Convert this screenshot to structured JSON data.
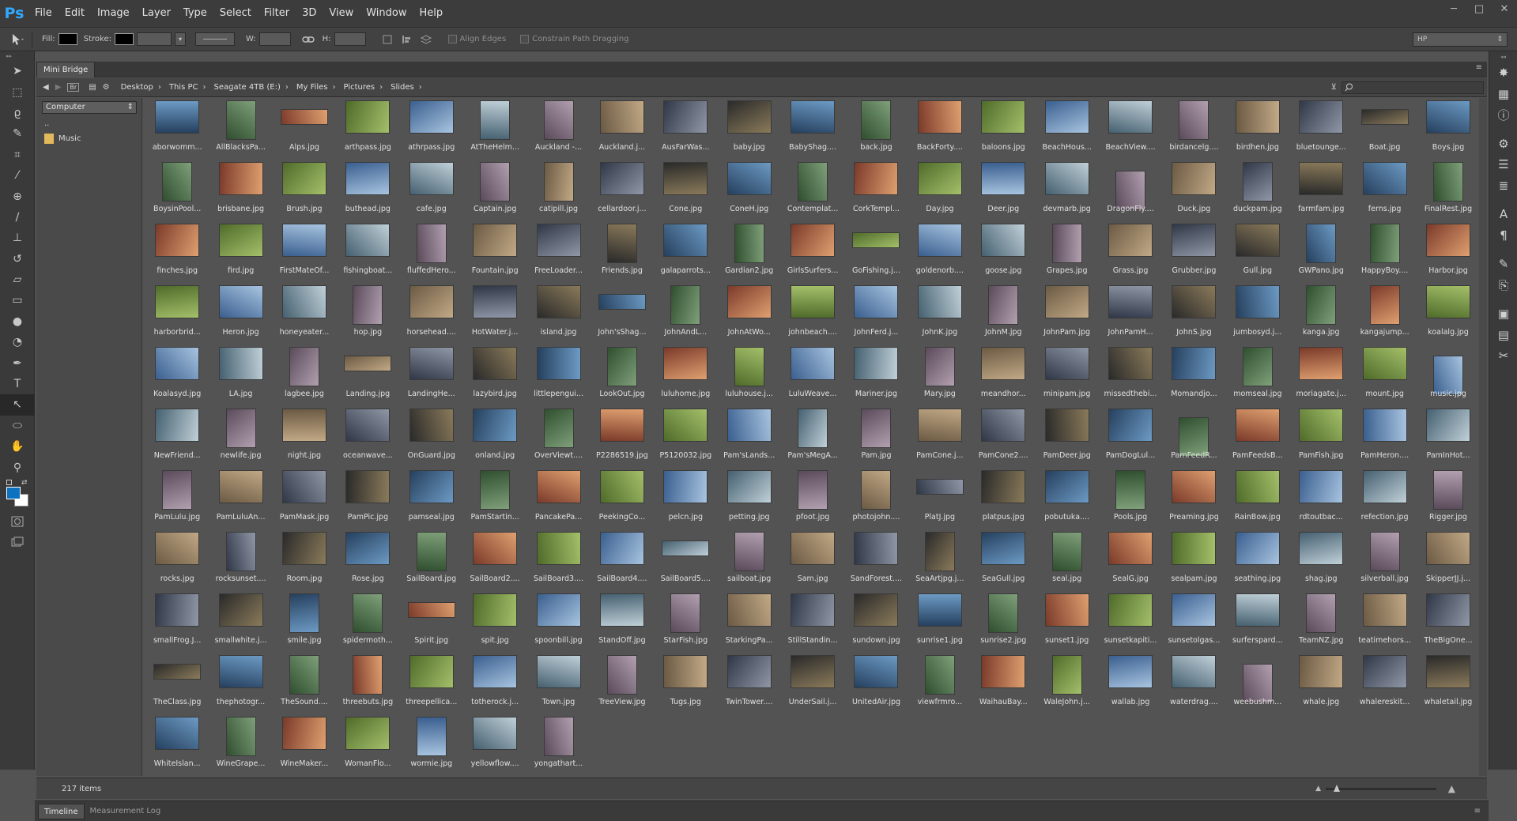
{
  "app": {
    "logo": "Ps"
  },
  "menus": [
    "File",
    "Edit",
    "Image",
    "Layer",
    "Type",
    "Select",
    "Filter",
    "3D",
    "View",
    "Window",
    "Help"
  ],
  "window_controls": [
    "─",
    "□",
    "✕"
  ],
  "options": {
    "fill_label": "Fill:",
    "stroke_label": "Stroke:",
    "w_label": "W:",
    "h_label": "H:",
    "align_edges": "Align Edges",
    "constrain": "Constrain Path Dragging",
    "workspace": "HP"
  },
  "panel": {
    "tab": "Mini Bridge",
    "location": "Computer",
    "folders": [
      "..",
      "Music"
    ]
  },
  "breadcrumb": [
    "Desktop",
    "This PC",
    "Seagate 4TB (E:)",
    "My Files",
    "Pictures",
    "Slides"
  ],
  "status": {
    "count": "217 items"
  },
  "bottom_tabs": [
    "Timeline",
    "Measurement Log"
  ],
  "icons": {
    "tools": [
      "move-icon",
      "marquee-icon",
      "lasso-icon",
      "quick-select-icon",
      "crop-icon",
      "eyedropper-icon",
      "healing-icon",
      "brush-icon",
      "stamp-icon",
      "history-brush-icon",
      "eraser-icon",
      "gradient-icon",
      "blur-icon",
      "dodge-icon",
      "pen-icon",
      "type-icon",
      "path-select-icon",
      "shape-icon",
      "hand-icon",
      "zoom-icon"
    ],
    "right": [
      "color-icon",
      "swatches-icon",
      "info-icon",
      "adjustments-icon",
      "layers-icon",
      "channels-icon",
      "character-icon",
      "paragraph-icon",
      "brushes-icon",
      "clone-source-icon",
      "navigator-icon",
      "notes-icon",
      "tool-presets-icon"
    ]
  },
  "files": [
    "aborwomm...",
    "AllBlacksPa...",
    "Alps.jpg",
    "arthpass.jpg",
    "athrpass.jpg",
    "AtTheHelm...",
    "Auckland -...",
    "Auckland.j...",
    "AusFarWas...",
    "baby.jpg",
    "BabyShag....",
    "back.jpg",
    "BackForty....",
    "baloons.jpg",
    "BeachHous...",
    "BeachView....",
    "birdancelg....",
    "birdhen.jpg",
    "bluetounge...",
    "Boat.jpg",
    "Boys.jpg",
    "BoysinPool...",
    "brisbane.jpg",
    "Brush.jpg",
    "buthead.jpg",
    "cafe.jpg",
    "Captain.jpg",
    "catipill.jpg",
    "cellardoor.j...",
    "Cone.jpg",
    "ConeH.jpg",
    "Contemplat...",
    "CorkTempl...",
    "Day.jpg",
    "Deer.jpg",
    "devmarb.jpg",
    "DragonFly....",
    "Duck.jpg",
    "duckpam.jpg",
    "farmfam.jpg",
    "ferns.jpg",
    "FinalRest.jpg",
    "finches.jpg",
    "fird.jpg",
    "FirstMateOf...",
    "fishingboat...",
    "fluffedHero...",
    "Fountain.jpg",
    "FreeLoader...",
    "Friends.jpg",
    "galaparrots...",
    "Gardian2.jpg",
    "GirlsSurfers...",
    "GoFishing.j...",
    "goldenorb....",
    "goose.jpg",
    "Grapes.jpg",
    "Grass.jpg",
    "Grubber.jpg",
    "Gull.jpg",
    "GWPano.jpg",
    "HappyBoy....",
    "Harbor.jpg",
    "harborbrid...",
    "Heron.jpg",
    "honeyeater...",
    "hop.jpg",
    "horsehead....",
    "HotWater.j...",
    "island.jpg",
    "John'sShag...",
    "JohnAndL...",
    "JohnAtWo...",
    "johnbeach....",
    "JohnFerd.j...",
    "JohnK.jpg",
    "JohnM.jpg",
    "JohnPam.jpg",
    "JohnPamH...",
    "JohnS.jpg",
    "jumbosyd.j...",
    "kanga.jpg",
    "kangajump...",
    "koalalg.jpg",
    "Koalasyd.jpg",
    "LA.jpg",
    "lagbee.jpg",
    "Landing.jpg",
    "LandingHe...",
    "lazybird.jpg",
    "littlepengui...",
    "LookOut.jpg",
    "luluhome.jpg",
    "luluhouse.j...",
    "LuluWeave...",
    "Mariner.jpg",
    "Mary.jpg",
    "meandhor...",
    "minipam.jpg",
    "missedthebi...",
    "Momandjo...",
    "momseal.jpg",
    "moriagate.j...",
    "mount.jpg",
    "music.jpg",
    "NewFriend...",
    "newlife.jpg",
    "night.jpg",
    "oceanwave...",
    "OnGuard.jpg",
    "onland.jpg",
    "OverViewt....",
    "P2286519.jpg",
    "P5120032.jpg",
    "Pam'sLands...",
    "Pam'sMegA...",
    "Pam.jpg",
    "PamCone.j...",
    "PamCone2....",
    "PamDeer.jpg",
    "PamDogLul...",
    "PamFeedR...",
    "PamFeedsB...",
    "PamFish.jpg",
    "PamHeron....",
    "PamInHot...",
    "PamLulu.jpg",
    "PamLuluAn...",
    "PamMask.jpg",
    "PamPic.jpg",
    "pamseal.jpg",
    "PamStartin...",
    "PancakePa...",
    "PeekingCo...",
    "pelcn.jpg",
    "petting.jpg",
    "pfoot.jpg",
    "photojohn....",
    "PlatJ.jpg",
    "platpus.jpg",
    "pobutuka....",
    "Pools.jpg",
    "Preaming.jpg",
    "RainBow.jpg",
    "rdtoutbac...",
    "refection.jpg",
    "Rigger.jpg",
    "rocks.jpg",
    "rocksunset....",
    "Room.jpg",
    "Rose.jpg",
    "SailBoard.jpg",
    "SailBoard2....",
    "SailBoard3....",
    "SailBoard4....",
    "SailBoard5....",
    "sailboat.jpg",
    "Sam.jpg",
    "SandForest....",
    "SeaArtjpg.j...",
    "SeaGull.jpg",
    "seal.jpg",
    "SealG.jpg",
    "sealpam.jpg",
    "seathing.jpg",
    "shag.jpg",
    "silverball.jpg",
    "SkipperJJ.j...",
    "smallFrog.J...",
    "smallwhite.j...",
    "smile.jpg",
    "spidermoth...",
    "Spirit.jpg",
    "spit.jpg",
    "spoonbill.jpg",
    "StandOff.jpg",
    "StarFish.jpg",
    "StarkingPa...",
    "StillStandin...",
    "sundown.jpg",
    "sunrise1.jpg",
    "sunrise2.jpg",
    "sunset1.jpg",
    "sunsetkapiti...",
    "sunsetolgas...",
    "surferspard...",
    "TeamNZ.jpg",
    "teatimehors...",
    "TheBigOne...",
    "TheClass.jpg",
    "thephotogr...",
    "TheSound....",
    "threebuts.jpg",
    "threepellica...",
    "totherock.j...",
    "Town.jpg",
    "TreeView.jpg",
    "Tugs.jpg",
    "TwinTower....",
    "UnderSail.j...",
    "UnitedAir.jpg",
    "viewfrmro...",
    "WaihauBay...",
    "WaleJohn.j...",
    "wallab.jpg",
    "waterdrag....",
    "weebushm...",
    "whale.jpg",
    "whalereskit...",
    "whaletail.jpg",
    "WhiteIslan...",
    "WineGrape...",
    "WineMaker...",
    "WomanFlo...",
    "wormie.jpg",
    "yellowflow....",
    "yongathart..."
  ]
}
